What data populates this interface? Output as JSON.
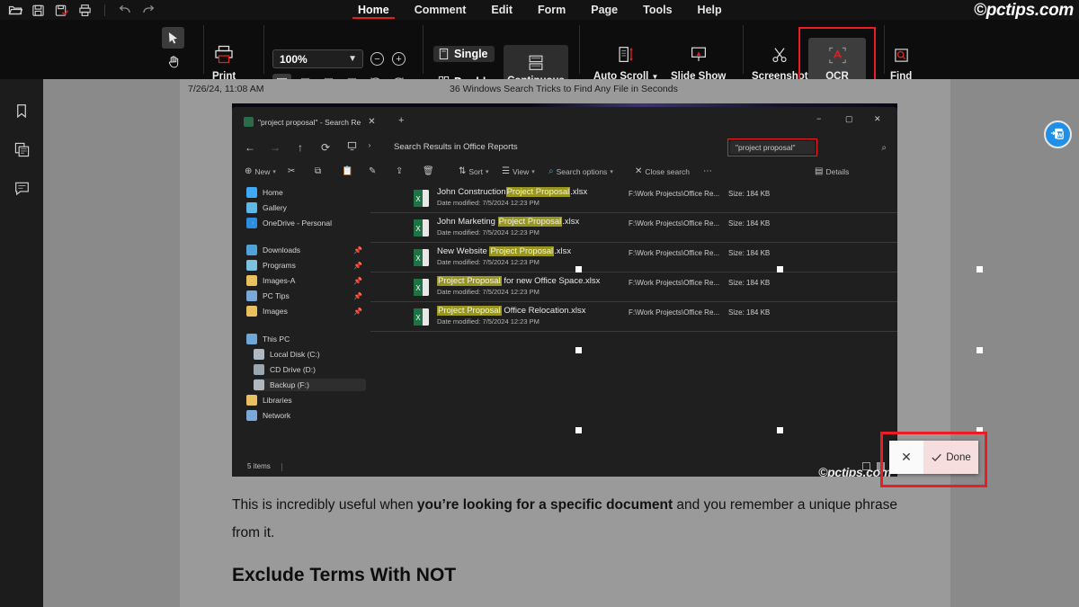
{
  "app": {
    "watermark_top": "©pctips.com",
    "watermark_shot": "©pctips.com"
  },
  "menu": {
    "tabs": [
      {
        "label": "Home",
        "active": true
      },
      {
        "label": "Comment",
        "active": false
      },
      {
        "label": "Edit",
        "active": false
      },
      {
        "label": "Form",
        "active": false
      },
      {
        "label": "Page",
        "active": false
      },
      {
        "label": "Tools",
        "active": false
      },
      {
        "label": "Help",
        "active": false
      }
    ],
    "quick_access": [
      "open-folder-icon",
      "save-icon",
      "save-as-icon",
      "print-quick-icon",
      "undo-icon",
      "redo-icon"
    ]
  },
  "ribbon": {
    "select_tool": "select-arrow-icon",
    "hand_tool": "hand-pan-icon",
    "print_label": "Print",
    "zoom": {
      "value": "100%",
      "zoom_out": "−",
      "zoom_in": "+"
    },
    "fit_modes": [
      "actual-size-icon",
      "fit-page-icon",
      "fit-width-icon",
      "fit-visible-icon"
    ],
    "rotate": [
      "rotate-left-icon",
      "rotate-right-icon"
    ],
    "page_single": "Single",
    "page_double": "Double",
    "continuous": "Continuous",
    "auto_scroll": "Auto Scroll",
    "slide_show": "Slide Show",
    "screenshot": "Screenshot",
    "ocr": "OCR",
    "find": "Find",
    "highlight_color": "#ec1c24"
  },
  "rail": {
    "items": [
      "bookmark-icon",
      "page-thumbnails-icon",
      "comments-icon"
    ]
  },
  "page_header": {
    "date": "7/26/24, 11:08 AM",
    "title": "36 Windows Search Tricks to Find Any File in Seconds"
  },
  "explorer": {
    "tab_title": "\"project proposal\" - Search Re",
    "tab_close": "✕",
    "new_tab": "+",
    "window_controls": [
      "−",
      "▢",
      "✕"
    ],
    "nav": {
      "back": "←",
      "forward": "→",
      "up": "↑",
      "refresh": "⟳"
    },
    "breadcrumb": "Search Results in Office Reports",
    "search_value": "\"project proposal\"",
    "search_icon": "search-icon",
    "commands": [
      {
        "label": "New",
        "icon": "new-icon",
        "caret": true
      },
      {
        "label": "",
        "icon": "cut-icon",
        "caret": false
      },
      {
        "label": "",
        "icon": "copy-icon",
        "caret": false
      },
      {
        "label": "",
        "icon": "paste-icon",
        "caret": false
      },
      {
        "label": "",
        "icon": "rename-icon",
        "caret": false
      },
      {
        "label": "",
        "icon": "share-icon",
        "caret": false
      },
      {
        "label": "",
        "icon": "delete-icon",
        "caret": false
      },
      {
        "label": "Sort",
        "icon": "sort-icon",
        "caret": true
      },
      {
        "label": "View",
        "icon": "view-icon",
        "caret": true
      },
      {
        "label": "Search options",
        "icon": "search-options-icon",
        "caret": true
      },
      {
        "label": "Close search",
        "icon": "close-search-icon",
        "caret": false
      },
      {
        "label": "",
        "icon": "more-icon",
        "caret": false
      },
      {
        "label": "Details",
        "icon": "details-icon",
        "caret": false
      }
    ],
    "sidebar": [
      {
        "label": "Home",
        "color": "#3fa9f5",
        "pin": false,
        "caret": false,
        "selected": false
      },
      {
        "label": "Gallery",
        "color": "#5fb7e8",
        "pin": false,
        "caret": false,
        "selected": false
      },
      {
        "label": "OneDrive - Personal",
        "color": "#2d8ee0",
        "pin": false,
        "caret": true,
        "selected": false
      },
      {
        "label": "Downloads",
        "color": "#4fa3d8",
        "pin": true,
        "caret": false,
        "selected": false
      },
      {
        "label": "Programs",
        "color": "#7ec0e0",
        "pin": true,
        "caret": false,
        "selected": false
      },
      {
        "label": "Images-A",
        "color": "#e8c060",
        "pin": true,
        "caret": false,
        "selected": false
      },
      {
        "label": "PC Tips",
        "color": "#7aa8d8",
        "pin": true,
        "caret": false,
        "selected": false
      },
      {
        "label": "Images",
        "color": "#e8c060",
        "pin": true,
        "caret": false,
        "selected": false
      },
      {
        "label": "This PC",
        "color": "#6fa8d8",
        "pin": false,
        "caret": false,
        "selected": false
      },
      {
        "label": "Local Disk (C:)",
        "color": "#b0b8bf",
        "pin": false,
        "caret": false,
        "selected": false
      },
      {
        "label": "CD Drive (D:)",
        "color": "#9aa6b0",
        "pin": false,
        "caret": false,
        "selected": false
      },
      {
        "label": "Backup (F:)",
        "color": "#b0b8bf",
        "pin": false,
        "caret": false,
        "selected": true
      },
      {
        "label": "Libraries",
        "color": "#e8c060",
        "pin": false,
        "caret": false,
        "selected": false
      },
      {
        "label": "Network",
        "color": "#7aa8d8",
        "pin": false,
        "caret": false,
        "selected": false
      }
    ],
    "files": [
      {
        "pre": "John Construction",
        "hl": "Project Proposal",
        "post": ".xlsx",
        "modified": "Date modified: 7/5/2024 12:23 PM",
        "path": "F:\\Work Projects\\Office Re...",
        "size": "Size: 184 KB"
      },
      {
        "pre": "John Marketing ",
        "hl": "Project Proposal",
        "post": ".xlsx",
        "modified": "Date modified: 7/5/2024 12:23 PM",
        "path": "F:\\Work Projects\\Office Re...",
        "size": "Size: 184 KB"
      },
      {
        "pre": "New Website ",
        "hl": "Project Proposal",
        "post": ".xlsx",
        "modified": "Date modified: 7/5/2024 12:23 PM",
        "path": "F:\\Work Projects\\Office Re...",
        "size": "Size: 184 KB"
      },
      {
        "pre": "",
        "hl": "Project Proposal",
        "post": " for new Office Space.xlsx",
        "modified": "Date modified: 7/5/2024 12:23 PM",
        "path": "F:\\Work Projects\\Office Re...",
        "size": "Size: 184 KB"
      },
      {
        "pre": "",
        "hl": "Project Proposal",
        "post": " Office Relocation.xlsx",
        "modified": "Date modified: 7/5/2024 12:23 PM",
        "path": "F:\\Work Projects\\Office Re...",
        "size": "Size: 184 KB"
      }
    ],
    "status": "5 items",
    "highlight_color": "#9a9720"
  },
  "ocr_popup": {
    "cancel": "✕",
    "confirm": "Done",
    "check_icon": "check-icon",
    "border_color": "#ec1c24"
  },
  "document": {
    "paragraph_part1": "This is incredibly useful when ",
    "paragraph_bold": "you’re looking for a specific document",
    "paragraph_part2": " and you remember a unique phrase from it.",
    "heading": "Exclude Terms With NOT"
  },
  "float_button": {
    "name": "convert-to-word-button",
    "label": "W",
    "color": "#1f8fe8"
  }
}
